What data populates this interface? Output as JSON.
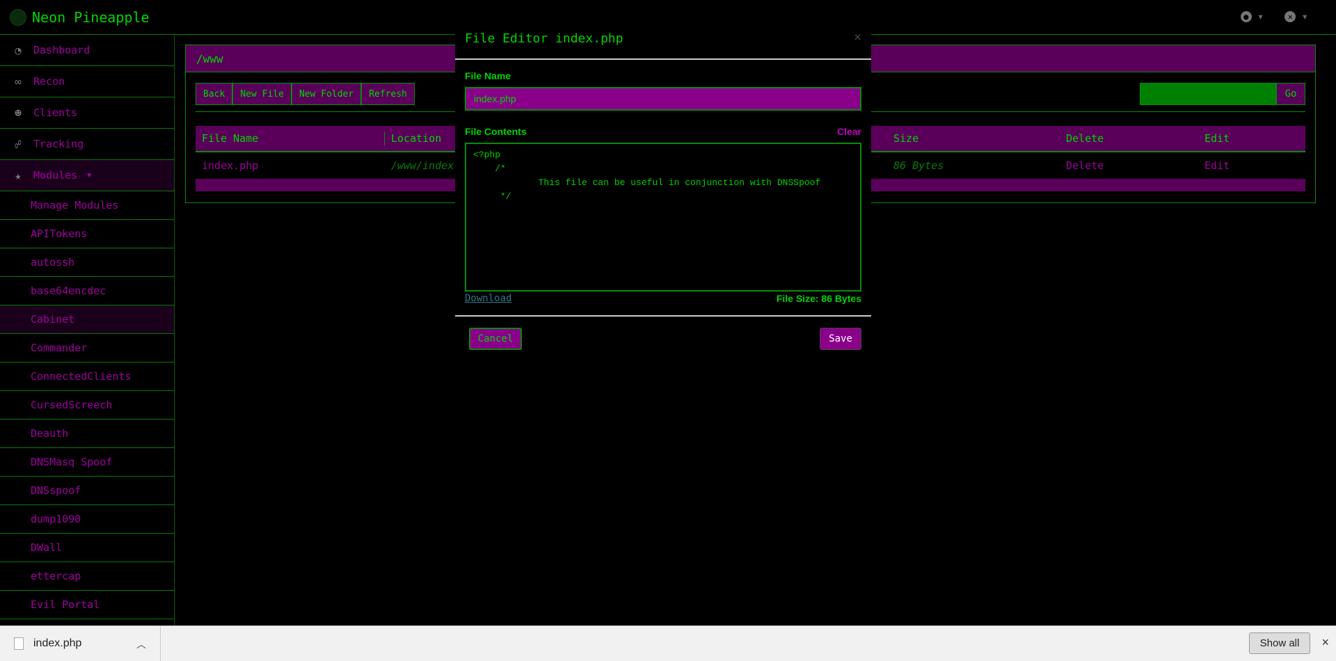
{
  "app": {
    "title": "Neon Pineapple"
  },
  "sidebar": {
    "items": [
      {
        "label": "Dashboard",
        "icon": "dashboard-icon"
      },
      {
        "label": "Recon",
        "icon": "binoculars-icon"
      },
      {
        "label": "Clients",
        "icon": "users-icon"
      },
      {
        "label": "Tracking",
        "icon": "tracking-icon"
      },
      {
        "label": "Modules",
        "icon": "star-icon"
      }
    ],
    "modules": [
      "Manage Modules",
      "APITokens",
      "autossh",
      "base64encdec",
      "Cabinet",
      "Commander",
      "ConnectedClients",
      "CursedScreech",
      "Deauth",
      "DNSMasq Spoof",
      "DNSspoof",
      "dump1090",
      "DWall",
      "ettercap",
      "Evil Portal"
    ]
  },
  "panel": {
    "path": "/www",
    "buttons": {
      "back": "Back",
      "new_file": "New File",
      "new_folder": "New Folder",
      "refresh": "Refresh"
    },
    "go": "Go",
    "columns": {
      "name": "File Name",
      "location": "Location",
      "size": "Size",
      "delete": "Delete",
      "edit": "Edit"
    },
    "rows": [
      {
        "name": "index.php",
        "location": "/www/index.",
        "size": "86 Bytes",
        "delete": "Delete",
        "edit": "Edit"
      }
    ]
  },
  "modal": {
    "title": "File Editor index.php",
    "close": "×",
    "file_name_label": "File Name",
    "file_name_value": "index.php",
    "file_contents_label": "File Contents",
    "clear": "Clear",
    "contents": "<?php\n    /*\n            This file can be useful in conjunction with DNSSpoof\n     */",
    "download": "Download",
    "file_size": "File Size: 86 Bytes",
    "cancel": "Cancel",
    "save": "Save"
  },
  "download_bar": {
    "file": "index.php",
    "show_all": "Show all",
    "close": "×"
  }
}
